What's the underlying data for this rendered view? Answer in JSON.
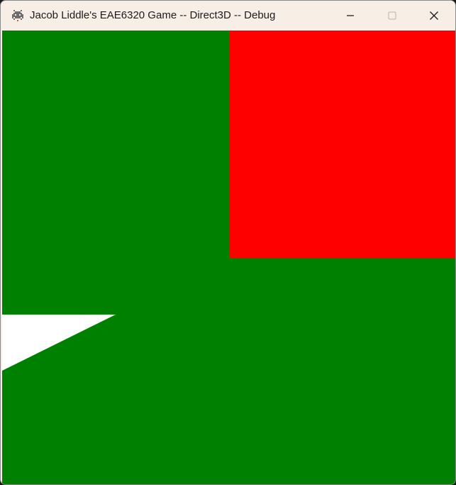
{
  "window": {
    "title": "Jacob Liddle's EAE6320 Game -- Direct3D -- Debug",
    "app_icon": "space-invader-icon",
    "caption_buttons": {
      "minimize": "minimize-icon",
      "maximize": "maximize-icon",
      "close": "close-icon"
    }
  },
  "scene": {
    "clear_color": "#008000",
    "objects": [
      {
        "shape": "rectangle",
        "color": "#ff0000"
      },
      {
        "shape": "triangle",
        "color": "#ffffff"
      }
    ]
  },
  "colors": {
    "titlebar": "#f7efe6",
    "background_green": "#008000",
    "red": "#ff0000",
    "white": "#ffffff"
  }
}
